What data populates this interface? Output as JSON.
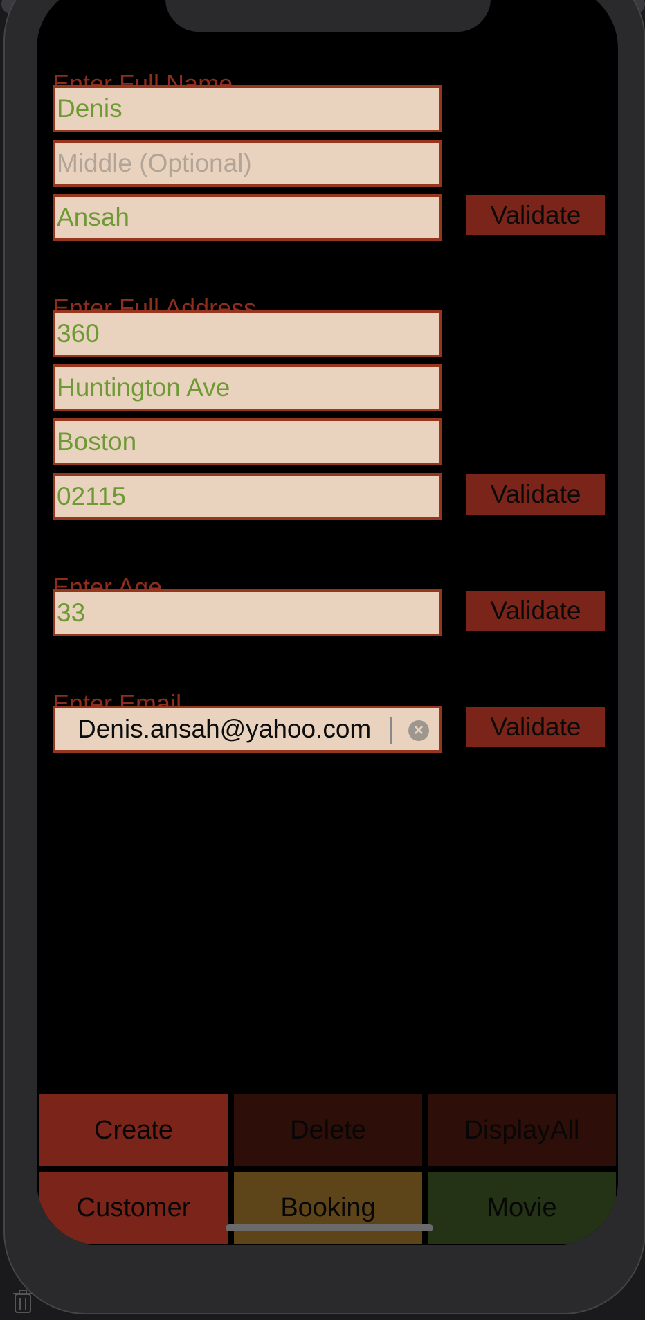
{
  "name_section": {
    "label": "Enter Full Name",
    "first_value": "Denis",
    "middle_placeholder": "Middle (Optional)",
    "last_value": "Ansah",
    "validate_label": "Validate"
  },
  "address_section": {
    "label": "Enter Full Address",
    "number_value": "360",
    "street_value": "Huntington Ave",
    "city_value": "Boston",
    "zip_value": "02115",
    "validate_label": "Validate"
  },
  "age_section": {
    "label": "Enter Age",
    "value": "33",
    "validate_label": "Validate"
  },
  "email_section": {
    "label": "Enter Email",
    "value": "Denis.ansah@yahoo.com",
    "validate_label": "Validate"
  },
  "actions": {
    "create": "Create",
    "delete": "Delete",
    "display_all": "DisplayAll"
  },
  "tabs": {
    "customer": "Customer",
    "booking": "Booking",
    "movie": "Movie"
  },
  "colors": {
    "label": "#8e2d1e",
    "field_bg": "#e9d3bf",
    "field_border": "#96361e",
    "field_text": "#6e9a35",
    "validate_bg": "#7b2419",
    "create_bg": "#7b2419",
    "delete_bg": "#2e0e08",
    "display_all_bg": "#2e0e08",
    "customer_bg": "#7b2419",
    "booking_bg": "#5e4519",
    "movie_bg": "#243216"
  }
}
